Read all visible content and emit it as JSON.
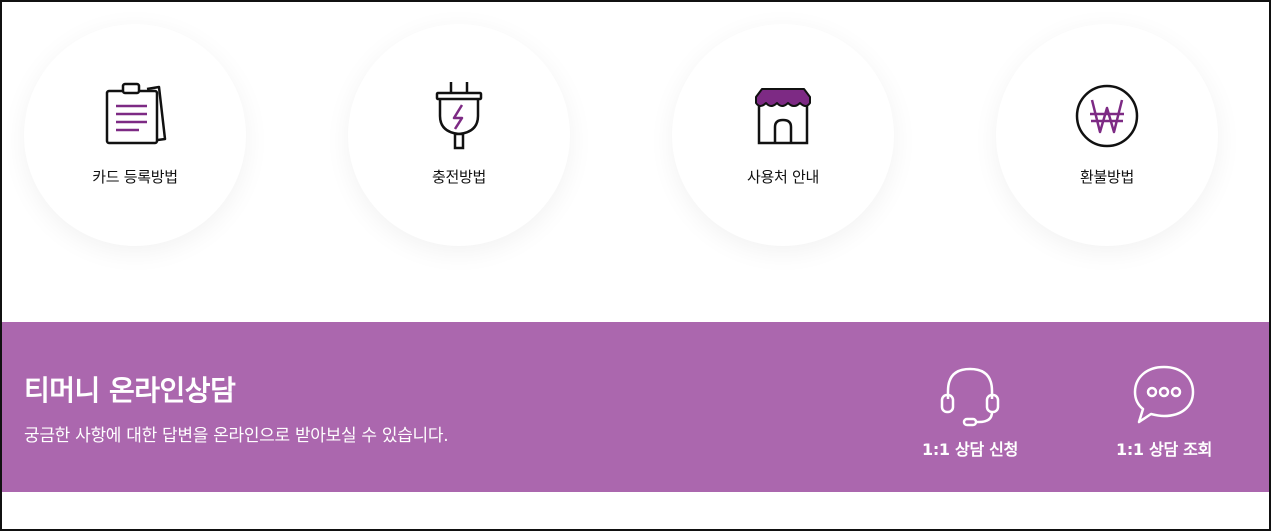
{
  "guide": {
    "items": [
      {
        "label": "카드 등록방법",
        "icon": "clipboard-icon"
      },
      {
        "label": "충전방법",
        "icon": "plug-icon"
      },
      {
        "label": "사용처 안내",
        "icon": "store-icon"
      },
      {
        "label": "환불방법",
        "icon": "won-coin-icon"
      }
    ]
  },
  "consult": {
    "title": "티머니 온라인상담",
    "subtitle": "궁금한 사항에 대한 답변을 온라인으로 받아보실 수 있습니다.",
    "apply_label": "1:1 상담 신청",
    "inquiry_label": "1:1 상담 조회"
  },
  "colors": {
    "accent": "#ab67ae",
    "icon_accent": "#7d2a84",
    "text": "#111111"
  }
}
